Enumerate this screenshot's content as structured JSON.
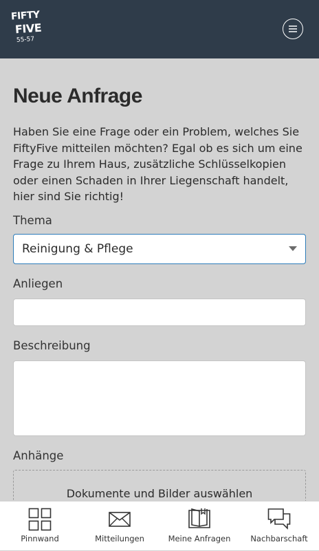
{
  "header": {
    "logo": {
      "line1": "FIFTY",
      "line2": "FIVE",
      "line3": "55-57"
    },
    "menu_icon": "hamburger-circle-icon",
    "colors": {
      "background": "#2f3c4a"
    }
  },
  "page": {
    "title": "Neue Anfrage",
    "intro": "Haben Sie eine Frage oder ein Problem, welches Sie FiftyFive mitteilen möchten? Egal ob es sich um eine Frage zu Ihrem Haus, zusätzliche Schlüsselkopien oder einen Schaden in Ihrer Liegenschaft handelt, hier sind Sie richtig!"
  },
  "form": {
    "thema_label": "Thema",
    "thema_value": "Reinigung & Pflege",
    "anliegen_label": "Anliegen",
    "anliegen_value": "",
    "beschreibung_label": "Beschreibung",
    "beschreibung_value": "",
    "anhaenge_label": "Anhänge",
    "upload_label": "Dokumente und Bilder auswählen",
    "colors": {
      "focus_border": "#2b7bb9"
    }
  },
  "tabbar": {
    "items": [
      {
        "label": "Pinnwand",
        "icon": "grid-icon"
      },
      {
        "label": "Mitteilungen",
        "icon": "envelope-icon"
      },
      {
        "label": "Meine Anfragen",
        "icon": "book-icon"
      },
      {
        "label": "Nachbarschaft",
        "icon": "chat-bubbles-icon"
      }
    ]
  }
}
